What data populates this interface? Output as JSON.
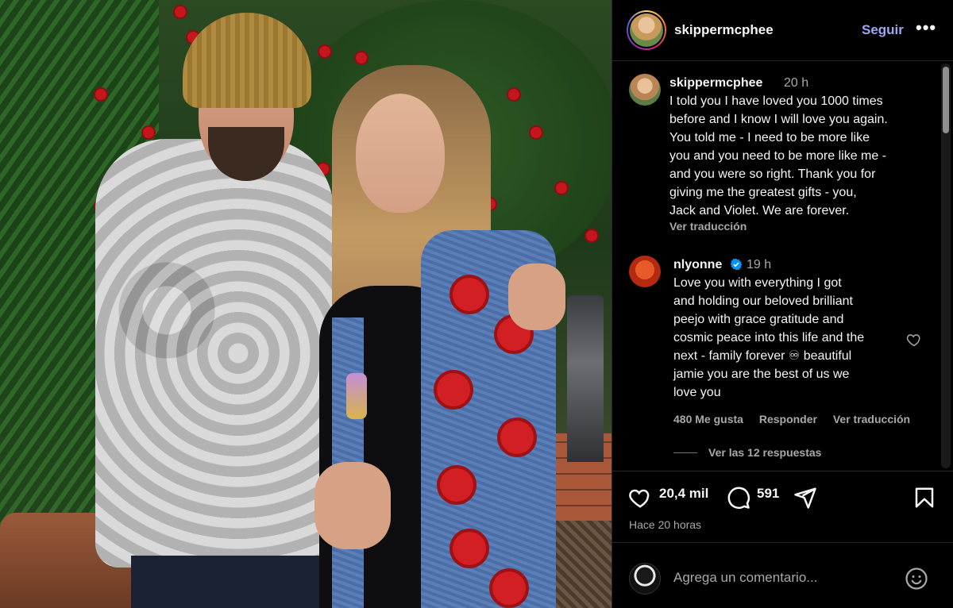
{
  "header": {
    "username": "skippermcphee",
    "follow_label": "Seguir",
    "more_label": "•••"
  },
  "comments": [
    {
      "username": "skippermcphee",
      "time": "20 h",
      "text": "I told you I have loved you 1000 times\nbefore and I know I will love you again.\nYou told me - I need to be more like\nyou and you need to be more like me -\nand you were so right.  Thank you for\ngiving me the greatest gifts -  you,\nJack and Violet. We are forever.",
      "translate_label": "Ver traducción"
    },
    {
      "username": "nlyonne",
      "verified": true,
      "time": "19 h",
      "text": "Love you with everything I got\nand holding our beloved brilliant\npeejo with grace gratitude and\ncosmic peace into this life and the\nnext - family forever ♾ beautiful\njamie you are the best of us we\nlove you",
      "likes_label": "480 Me gusta",
      "reply_label": "Responder",
      "translate_label": "Ver traducción",
      "view_replies_label": "Ver las 12 respuestas"
    }
  ],
  "post_actions": {
    "likes": "20,4 mil",
    "comments": "591",
    "posted_ago": "Hace 20 horas"
  },
  "compose": {
    "placeholder": "Agrega un comentario..."
  },
  "colors": {
    "follow_blue": "#a2a6f2",
    "verified_blue": "#0095f6",
    "secondary_text": "#a8a8a8",
    "panel_bg": "#000000"
  },
  "icons": [
    "heart-icon",
    "comment-icon",
    "share-icon",
    "bookmark-icon",
    "emoji-icon",
    "verified-icon",
    "more-options-icon"
  ]
}
